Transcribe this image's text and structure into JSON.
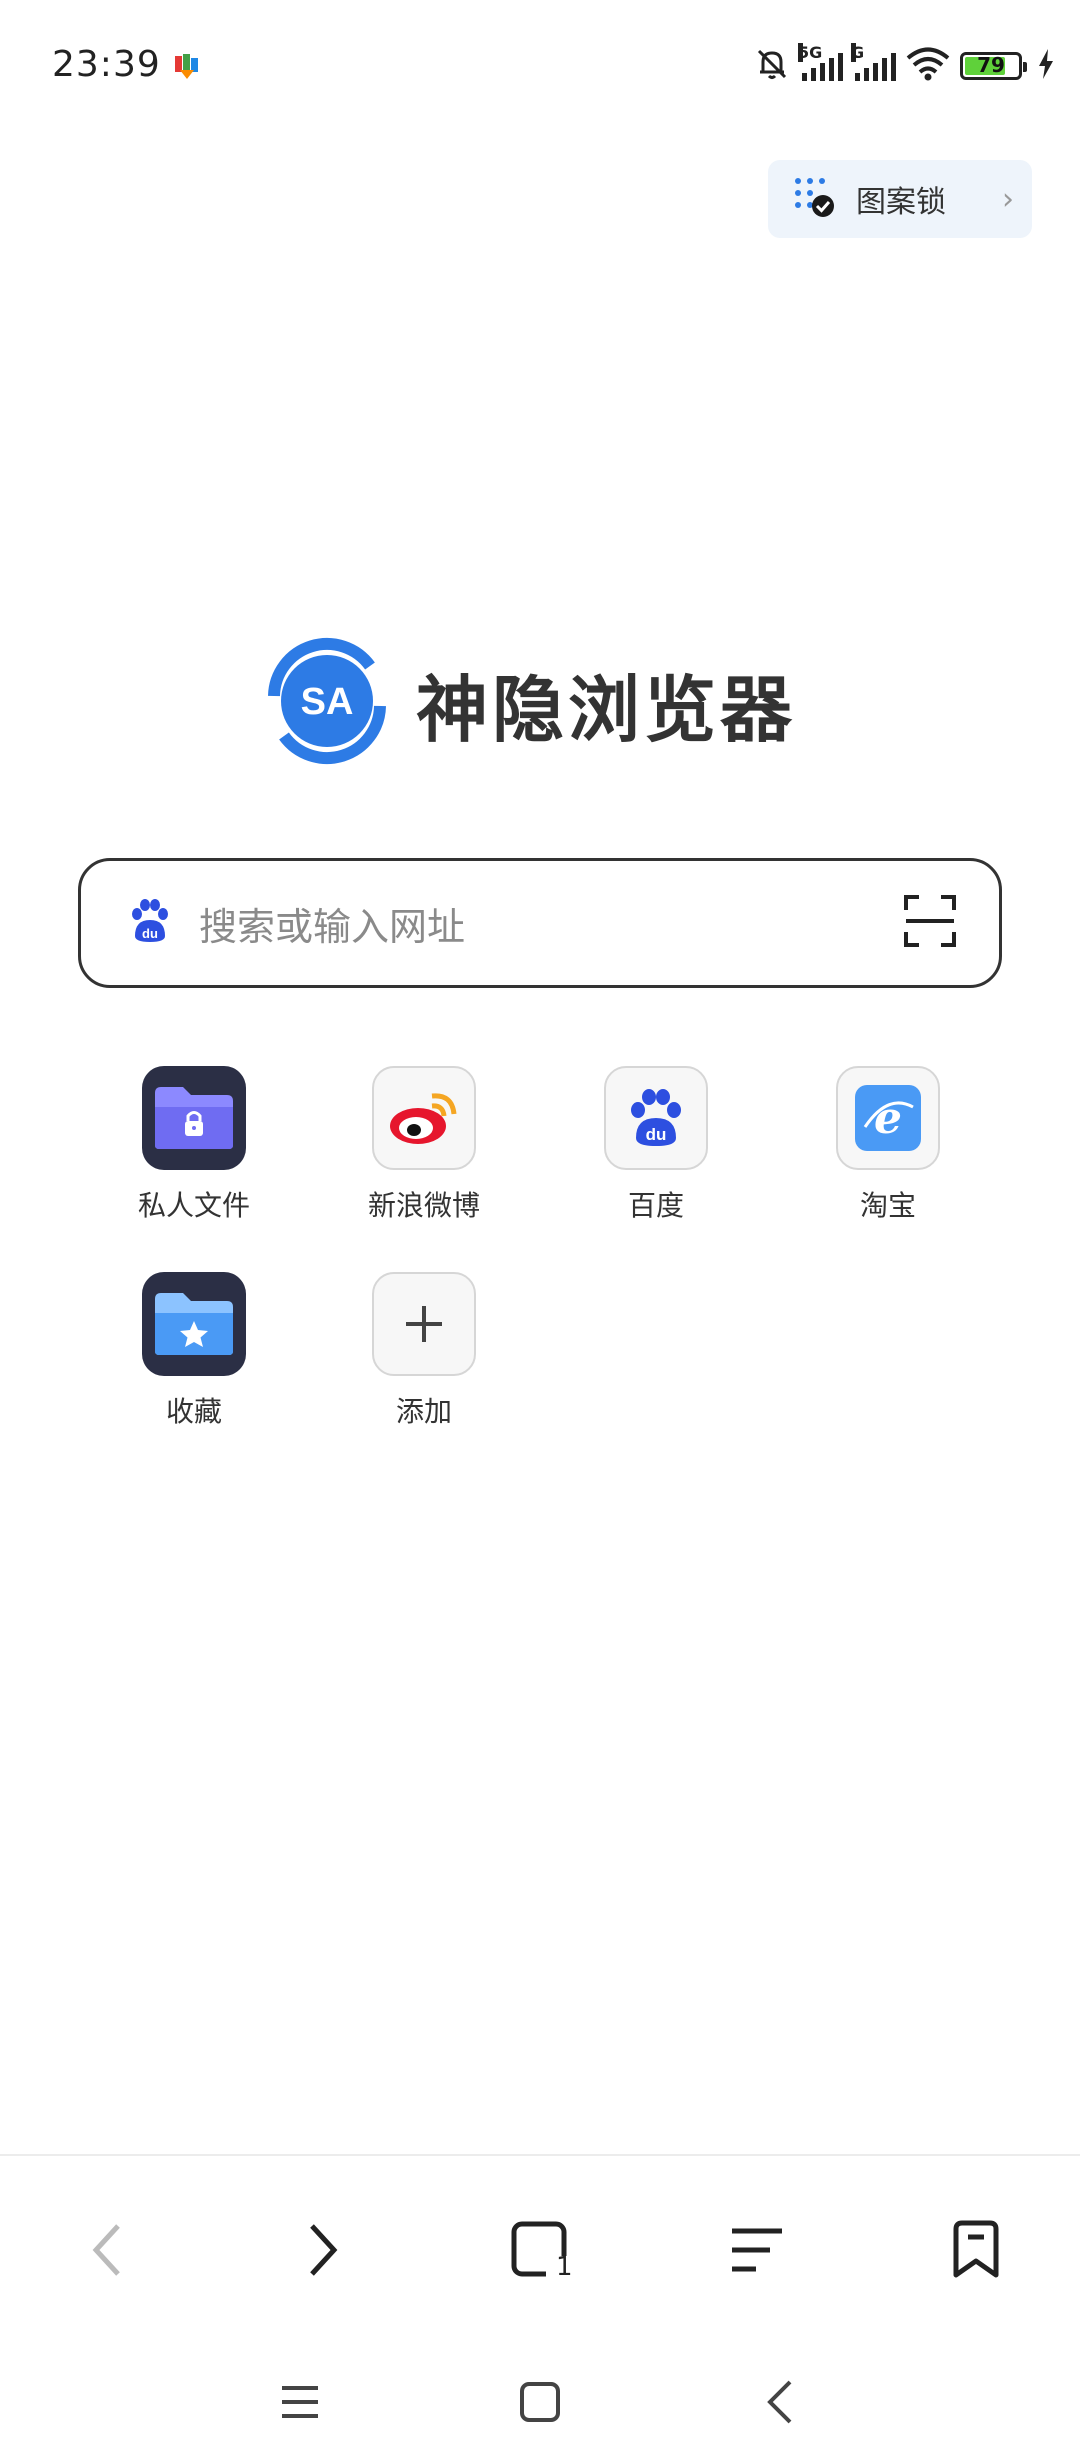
{
  "status_bar": {
    "time": "23:39",
    "network_1": "5G",
    "network_2": "G",
    "battery_level": "79"
  },
  "pattern_lock": {
    "label": "图案锁"
  },
  "brand": {
    "name": "神隐浏览器",
    "logo_text": "SA"
  },
  "search": {
    "placeholder": "搜索或输入网址"
  },
  "shortcuts": [
    {
      "label": "私人文件",
      "icon": "private-folder-icon"
    },
    {
      "label": "新浪微博",
      "icon": "weibo-icon"
    },
    {
      "label": "百度",
      "icon": "baidu-paw-icon"
    },
    {
      "label": "淘宝",
      "icon": "ie-browser-icon"
    },
    {
      "label": "收藏",
      "icon": "favorites-folder-icon"
    },
    {
      "label": "添加",
      "icon": "plus-icon"
    }
  ],
  "toolbar": {
    "tab_count": "1"
  },
  "colors": {
    "accent_blue": "#2d7be5",
    "folder_purple": "#6f6cf2",
    "battery_green": "#5fd13a",
    "pill_bg": "#eef4fb"
  }
}
